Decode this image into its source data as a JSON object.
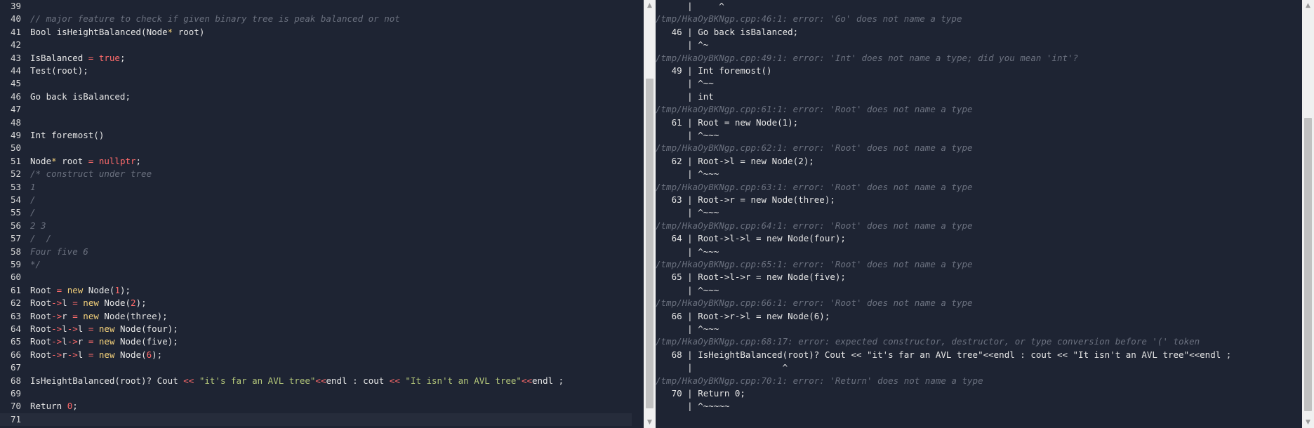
{
  "editor": {
    "lines": [
      {
        "n": "39",
        "t": ""
      },
      {
        "n": "40",
        "t": "// major feature to check if given binary tree is peak balanced or not",
        "cls": "comment"
      },
      {
        "n": "41",
        "t": "Bool isHeightBalanced(Node* root)"
      },
      {
        "n": "42",
        "t": ""
      },
      {
        "n": "43",
        "t": "IsBalanced = true;"
      },
      {
        "n": "44",
        "t": "Test(root);"
      },
      {
        "n": "45",
        "t": ""
      },
      {
        "n": "46",
        "t": "Go back isBalanced;"
      },
      {
        "n": "47",
        "t": ""
      },
      {
        "n": "48",
        "t": ""
      },
      {
        "n": "49",
        "t": "Int foremost()"
      },
      {
        "n": "50",
        "t": ""
      },
      {
        "n": "51",
        "t": "Node* root = nullptr;"
      },
      {
        "n": "52",
        "t": "/* construct under tree",
        "cls": "comment"
      },
      {
        "n": "53",
        "t": "1",
        "cls": "comment"
      },
      {
        "n": "54",
        "t": "/",
        "cls": "comment"
      },
      {
        "n": "55",
        "t": "/",
        "cls": "comment"
      },
      {
        "n": "56",
        "t": "2 3",
        "cls": "comment"
      },
      {
        "n": "57",
        "t": "/  /",
        "cls": "comment"
      },
      {
        "n": "58",
        "t": "Four five 6",
        "cls": "comment"
      },
      {
        "n": "59",
        "t": "*/",
        "cls": "comment"
      },
      {
        "n": "60",
        "t": ""
      },
      {
        "n": "61",
        "t": "Root = new Node(1);"
      },
      {
        "n": "62",
        "t": "Root->l = new Node(2);"
      },
      {
        "n": "63",
        "t": "Root->r = new Node(three);"
      },
      {
        "n": "64",
        "t": "Root->l->l = new Node(four);"
      },
      {
        "n": "65",
        "t": "Root->l->r = new Node(five);"
      },
      {
        "n": "66",
        "t": "Root->r->l = new Node(6);"
      },
      {
        "n": "67",
        "t": ""
      },
      {
        "n": "68",
        "t": "IsHeightBalanced(root)? Cout << \"it's far an AVL tree\"<<endl : cout << \"It isn't an AVL tree\"<<endl ;"
      },
      {
        "n": "69",
        "t": ""
      },
      {
        "n": "70",
        "t": "Return 0;"
      },
      {
        "n": "71",
        "t": ""
      }
    ]
  },
  "output": {
    "lines": [
      {
        "t": "      |     ^",
        "cls": "gut"
      },
      {
        "t": "/tmp/HkaOyBKNgp.cpp:46:1: error: 'Go' does not name a type",
        "cls": "err"
      },
      {
        "t": "   46 | Go back isBalanced;",
        "cls": "gut"
      },
      {
        "t": "      | ^~",
        "cls": "gut"
      },
      {
        "t": "/tmp/HkaOyBKNgp.cpp:49:1: error: 'Int' does not name a type; did you mean 'int'?",
        "cls": "err"
      },
      {
        "t": "   49 | Int foremost()",
        "cls": "gut"
      },
      {
        "t": "      | ^~~",
        "cls": "gut"
      },
      {
        "t": "      | int",
        "cls": "gut"
      },
      {
        "t": "/tmp/HkaOyBKNgp.cpp:61:1: error: 'Root' does not name a type",
        "cls": "err"
      },
      {
        "t": "   61 | Root = new Node(1);",
        "cls": "gut"
      },
      {
        "t": "      | ^~~~",
        "cls": "gut"
      },
      {
        "t": "/tmp/HkaOyBKNgp.cpp:62:1: error: 'Root' does not name a type",
        "cls": "err"
      },
      {
        "t": "   62 | Root->l = new Node(2);",
        "cls": "gut"
      },
      {
        "t": "      | ^~~~",
        "cls": "gut"
      },
      {
        "t": "/tmp/HkaOyBKNgp.cpp:63:1: error: 'Root' does not name a type",
        "cls": "err"
      },
      {
        "t": "   63 | Root->r = new Node(three);",
        "cls": "gut"
      },
      {
        "t": "      | ^~~~",
        "cls": "gut"
      },
      {
        "t": "/tmp/HkaOyBKNgp.cpp:64:1: error: 'Root' does not name a type",
        "cls": "err"
      },
      {
        "t": "   64 | Root->l->l = new Node(four);",
        "cls": "gut"
      },
      {
        "t": "      | ^~~~",
        "cls": "gut"
      },
      {
        "t": "/tmp/HkaOyBKNgp.cpp:65:1: error: 'Root' does not name a type",
        "cls": "err"
      },
      {
        "t": "   65 | Root->l->r = new Node(five);",
        "cls": "gut"
      },
      {
        "t": "      | ^~~~",
        "cls": "gut"
      },
      {
        "t": "/tmp/HkaOyBKNgp.cpp:66:1: error: 'Root' does not name a type",
        "cls": "err"
      },
      {
        "t": "   66 | Root->r->l = new Node(6);",
        "cls": "gut"
      },
      {
        "t": "      | ^~~~",
        "cls": "gut"
      },
      {
        "t": "/tmp/HkaOyBKNgp.cpp:68:17: error: expected constructor, destructor, or type conversion before '(' token",
        "cls": "err"
      },
      {
        "t": "   68 | IsHeightBalanced(root)? Cout << \"it's far an AVL tree\"<<endl : cout << \"It isn't an AVL tree\"<<endl ;",
        "cls": "gut"
      },
      {
        "t": "      |                 ^",
        "cls": "gut"
      },
      {
        "t": "/tmp/HkaOyBKNgp.cpp:70:1: error: 'Return' does not name a type",
        "cls": "err"
      },
      {
        "t": "   70 | Return 0;",
        "cls": "gut"
      },
      {
        "t": "      | ^~~~~~",
        "cls": "gut"
      }
    ]
  },
  "icons": {
    "up": "▲",
    "down": "▼"
  },
  "colors": {
    "background": "#1e2433",
    "operator": "#ff6b6b",
    "string": "#b4c77a",
    "comment": "#6b717f",
    "keyword_new": "#f3d07a"
  }
}
